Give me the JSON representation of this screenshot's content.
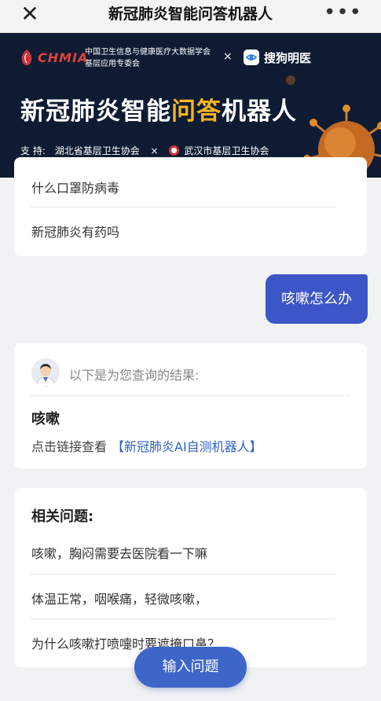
{
  "topbar": {
    "title": "新冠肺炎智能问答机器人",
    "close_icon": "close-icon",
    "more_icon": "more-icon"
  },
  "banner": {
    "logo_text": "CHMIA",
    "assoc_line1": "中国卫生信息与健康医疗大数据学会",
    "assoc_line2": "基层应用专委会",
    "times": "×",
    "partner": "搜狗明医",
    "title_part1": "新冠肺炎智能",
    "title_highlight": "问答",
    "title_part2": "机器人",
    "support_label": "支 持:",
    "support_org1": "湖北省基层卫生协会",
    "support_org2": "武汉市基层卫生协会",
    "colors": {
      "background": "#0e1b33",
      "highlight": "#f5b51b"
    }
  },
  "prev_card": {
    "items": [
      "什么口罩防病毒",
      "新冠肺炎有药吗"
    ]
  },
  "user_message": "咳嗽怎么办",
  "result_card": {
    "avatar": "doctor-avatar",
    "label": "以下是为您查询的结果:",
    "keyword": "咳嗽",
    "link_prefix": "点击链接查看",
    "link_text": "【新冠肺炎AI自测机器人】"
  },
  "related": {
    "heading": "相关问题:",
    "questions": [
      "咳嗽，胸闷需要去医院看一下嘛",
      "体温正常，咽喉痛，轻微咳嗽，",
      "为什么咳嗽打喷嚏时要遮掩口鼻？"
    ]
  },
  "input_button": "输入问题",
  "colors": {
    "accent": "#3e66c9",
    "user_bubble": "#3c56c8",
    "link": "#2f62c3"
  }
}
